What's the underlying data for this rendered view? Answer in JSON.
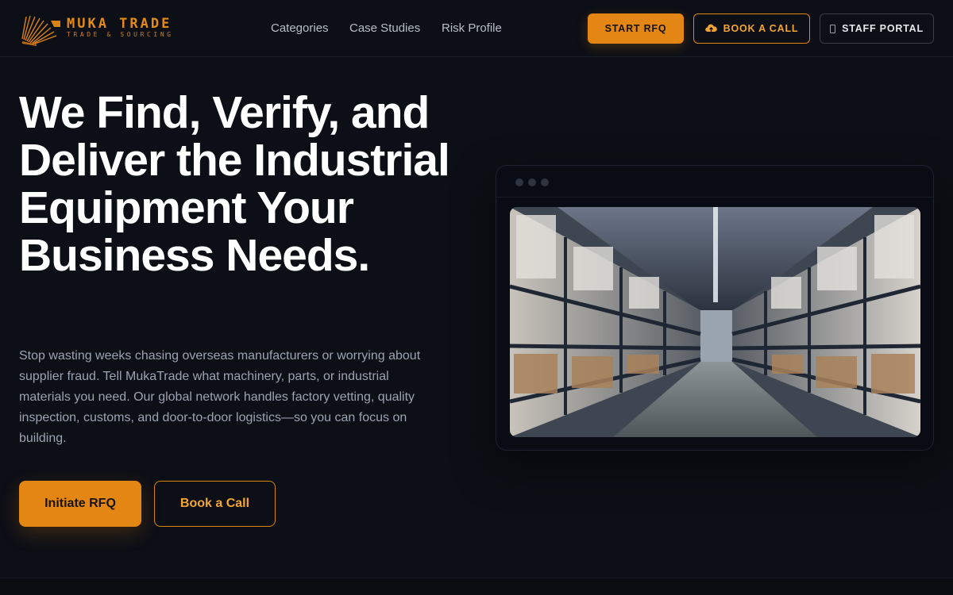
{
  "brand": {
    "name": "MUKA TRADE",
    "tagline": "TRADE & SOURCING",
    "accent": "#e48613"
  },
  "nav": {
    "items": [
      "Categories",
      "Case Studies",
      "Risk Profile"
    ]
  },
  "header_actions": {
    "start_rfq": "START RFQ",
    "book_call": "BOOK A CALL",
    "staff_portal": "STAFF PORTAL",
    "book_call_icon": "cloud-upload-icon",
    "staff_portal_icon": "phone-icon"
  },
  "hero": {
    "title": "We Find, Verify, and Deliver the Industrial Equipment Your Business Needs.",
    "description": "Stop wasting weeks chasing overseas manufacturers or worrying about supplier fraud. Tell MukaTrade what machinery, parts, or industrial materials you need. Our global network handles factory vetting, quality inspection, customs, and door-to-door logistics—so you can focus on building.",
    "primary_cta": "Initiate RFQ",
    "secondary_cta": "Book a Call"
  },
  "preview": {
    "image_subject": "warehouse-aisle-photo"
  }
}
